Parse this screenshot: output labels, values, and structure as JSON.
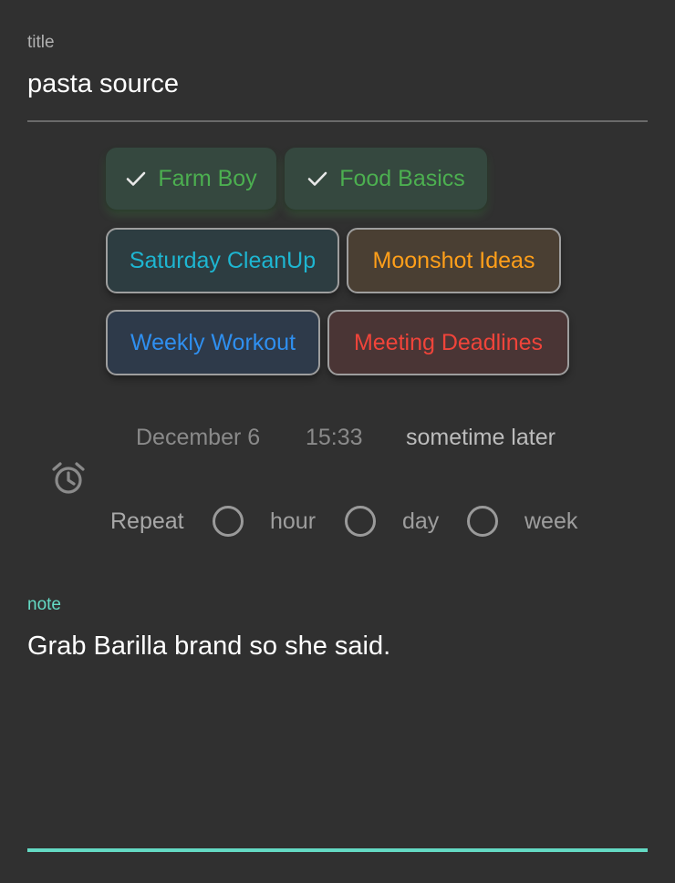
{
  "title_field": {
    "label": "title",
    "value": "pasta source"
  },
  "tags": [
    {
      "label": "Farm Boy",
      "selected": true,
      "color": "#4caf50"
    },
    {
      "label": "Food Basics",
      "selected": true,
      "color": "#4caf50"
    },
    {
      "label": "Saturday CleanUp",
      "selected": false,
      "color": "#1eb6d1"
    },
    {
      "label": "Moonshot Ideas",
      "selected": false,
      "color": "#ff9f1a"
    },
    {
      "label": "Weekly Workout",
      "selected": false,
      "color": "#2f8fef"
    },
    {
      "label": "Meeting Deadlines",
      "selected": false,
      "color": "#f0443a"
    }
  ],
  "reminder": {
    "date": "December 6",
    "time": "15:33",
    "later": "sometime later",
    "icon": "alarm-clock-icon"
  },
  "repeat": {
    "label": "Repeat",
    "options": [
      "hour",
      "day",
      "week"
    ]
  },
  "note_field": {
    "label": "note",
    "value": "Grab Barilla brand so she said."
  },
  "colors": {
    "background": "#303030",
    "accent": "#64dac4",
    "selected_chip_bg": "#35483f"
  }
}
